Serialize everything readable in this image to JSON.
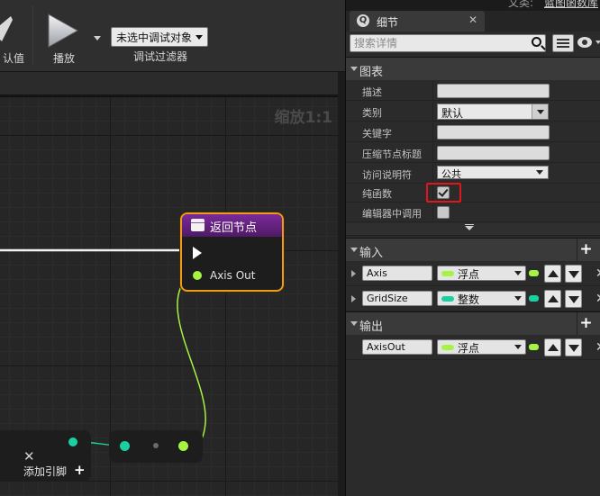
{
  "toolbar": {
    "default_value_label": "认值",
    "play_label": "播放",
    "debug_object_value": "未选中调试对象",
    "debug_filter_label": "调试过滤器"
  },
  "graph": {
    "zoom_label": "缩放1:1",
    "return_node": {
      "title": "返回节点",
      "output_pin": "Axis Out"
    },
    "entry_node": {
      "add_pin_label": "添加引脚"
    }
  },
  "details": {
    "window_title_fragment": "文类:",
    "parent_class_link": "蓝图函数库",
    "tab_title": "细节",
    "search_placeholder": "搜索详情",
    "graph_section": {
      "title": "图表",
      "rows": [
        {
          "label": "描述",
          "kind": "text",
          "value": ""
        },
        {
          "label": "类别",
          "kind": "combo",
          "value": "默认"
        },
        {
          "label": "关键字",
          "kind": "text",
          "value": ""
        },
        {
          "label": "压缩节点标题",
          "kind": "text",
          "value": ""
        },
        {
          "label": "访问说明符",
          "kind": "combo",
          "value": "公共"
        },
        {
          "label": "纯函数",
          "kind": "checkbox",
          "checked": true
        },
        {
          "label": "编辑器中调用",
          "kind": "checkbox",
          "checked": false
        }
      ]
    },
    "inputs_section": {
      "title": "输入",
      "params": [
        {
          "name": "Axis",
          "type": "浮点",
          "color": "#a5f343"
        },
        {
          "name": "GridSize",
          "type": "整数",
          "color": "#1bd0a0"
        }
      ]
    },
    "outputs_section": {
      "title": "输出",
      "params": [
        {
          "name": "AxisOut",
          "type": "浮点",
          "color": "#a5f343"
        }
      ]
    }
  },
  "colors": {
    "float_pin": "#a5f343",
    "int_pin": "#1bd0a0",
    "return_node_border": "#ee9b1c",
    "highlight_box": "#e0161c"
  }
}
